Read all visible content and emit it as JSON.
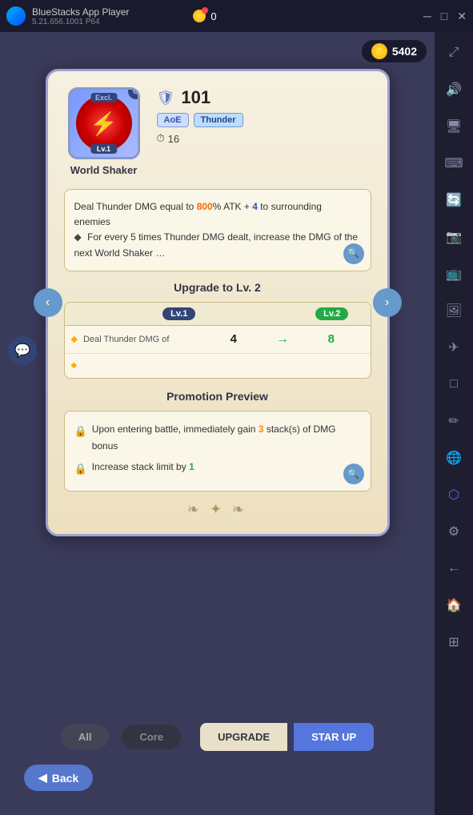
{
  "titleBar": {
    "appName": "BlueStacks App Player",
    "version": "5.21.656.1001 P64",
    "backArrow": "←",
    "coinCount": "0",
    "controls": [
      "─",
      "□",
      "✕"
    ]
  },
  "topBar": {
    "coinValue": "5402"
  },
  "card": {
    "skillName": "World Shaker",
    "levelIcon": "🛡",
    "levelNum": "101",
    "tagAoe": "AoE",
    "tagThunder": "Thunder",
    "rangeIcon": "⏱",
    "rangeValue": "16",
    "excl": "Excl.",
    "lv": "Lv.1",
    "cBadge": "C",
    "description": {
      "line1prefix": "Deal Thunder DMG equal to ",
      "line1highlight1": "800",
      "line1mid": "% ATK + ",
      "line1highlight2": "4",
      "line1suffix": " to surrounding enemies",
      "line2prefix": "For every 5 times Thunder DMG dealt, increase the DMG of the next World Shaker …"
    },
    "upgradeSection": {
      "title": "Upgrade to Lv. 2",
      "lv1Label": "Lv.1",
      "lv2Label": "Lv.2",
      "row1Label": "Deal Thunder DMG of",
      "row1Val1": "4",
      "row1Arrow": "→",
      "row1Val2": "8"
    },
    "promotionSection": {
      "title": "Promotion Preview",
      "row1prefix": "Upon entering battle, immediately gain ",
      "row1highlight": "3",
      "row1suffix": " stack(s) of DMG bonus",
      "row2prefix": "Increase stack limit by ",
      "row2highlight": "1"
    },
    "deco": "❧ ✦ ❧"
  },
  "bottomBar": {
    "tabAll": "All",
    "tabCore": "Core",
    "btnUpgrade": "UPGRADE",
    "btnStarUp": "STAR UP"
  },
  "backButton": {
    "arrow": "◀",
    "label": "Back"
  },
  "sidebar": {
    "icons": [
      "⤢",
      "🔊",
      "🖥",
      "📅",
      "🔄",
      "📷",
      "📺",
      "🖼",
      "✈",
      "□",
      "✏",
      "🌐",
      "⬡",
      "🌀"
    ]
  }
}
